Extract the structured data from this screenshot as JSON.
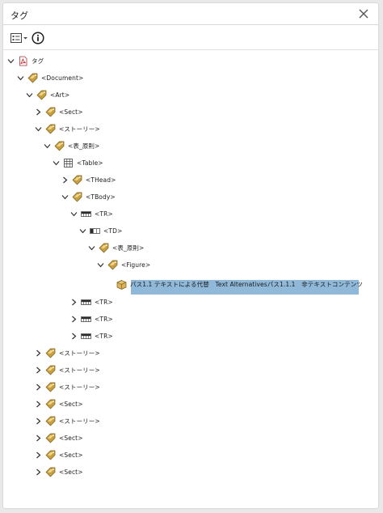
{
  "panel": {
    "title": "タグ"
  },
  "toolbar": {
    "options_icon": "options-menu-icon",
    "info_icon": "info-icon"
  },
  "tree": {
    "root": "タグ",
    "document": "<Document>",
    "art": "<Art>",
    "sect1": "<Sect>",
    "story1": "<ストーリー>",
    "table_rule1": "<表_原則>",
    "table": "<Table>",
    "thead": "<THead>",
    "tbody": "<TBody>",
    "tr1": "<TR>",
    "td": "<TD>",
    "table_rule2": "<表_原則>",
    "figure": "<Figure>",
    "figure_content": "パス1.1 テキストによる代替　Text Alternativesパス1.1.1　非テキストコンテンツ",
    "tr2": "<TR>",
    "tr3": "<TR>",
    "tr4": "<TR>",
    "story2": "<ストーリー>",
    "story3": "<ストーリー>",
    "story4": "<ストーリー>",
    "sect2": "<Sect>",
    "story5": "<ストーリー>",
    "sect3": "<Sect>",
    "sect4": "<Sect>",
    "sect5": "<Sect>"
  },
  "colors": {
    "selection": "#8fb8d9",
    "tag_icon": "#c9a040"
  }
}
